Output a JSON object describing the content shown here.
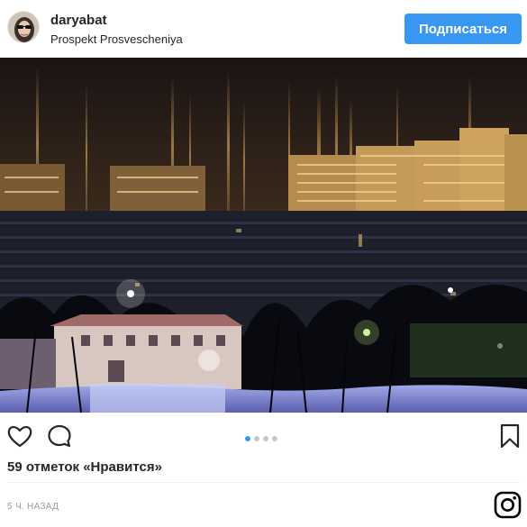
{
  "post": {
    "username": "daryabat",
    "location": "Prospekt Prosvescheniya",
    "follow_label": "Подписаться",
    "likes_text": "59 отметок «Нравится»",
    "timestamp": "5 Ч. НАЗАД"
  },
  "carousel": {
    "total": 4,
    "active_index": 0
  },
  "colors": {
    "follow_button": "#3897f0",
    "active_dot": "#3897f0",
    "inactive_dot": "#c7c7c7",
    "text": "#262626",
    "muted": "#999999"
  },
  "icons": {
    "like": "heart-icon",
    "comment": "comment-icon",
    "bookmark": "bookmark-icon",
    "brand": "instagram-icon"
  }
}
